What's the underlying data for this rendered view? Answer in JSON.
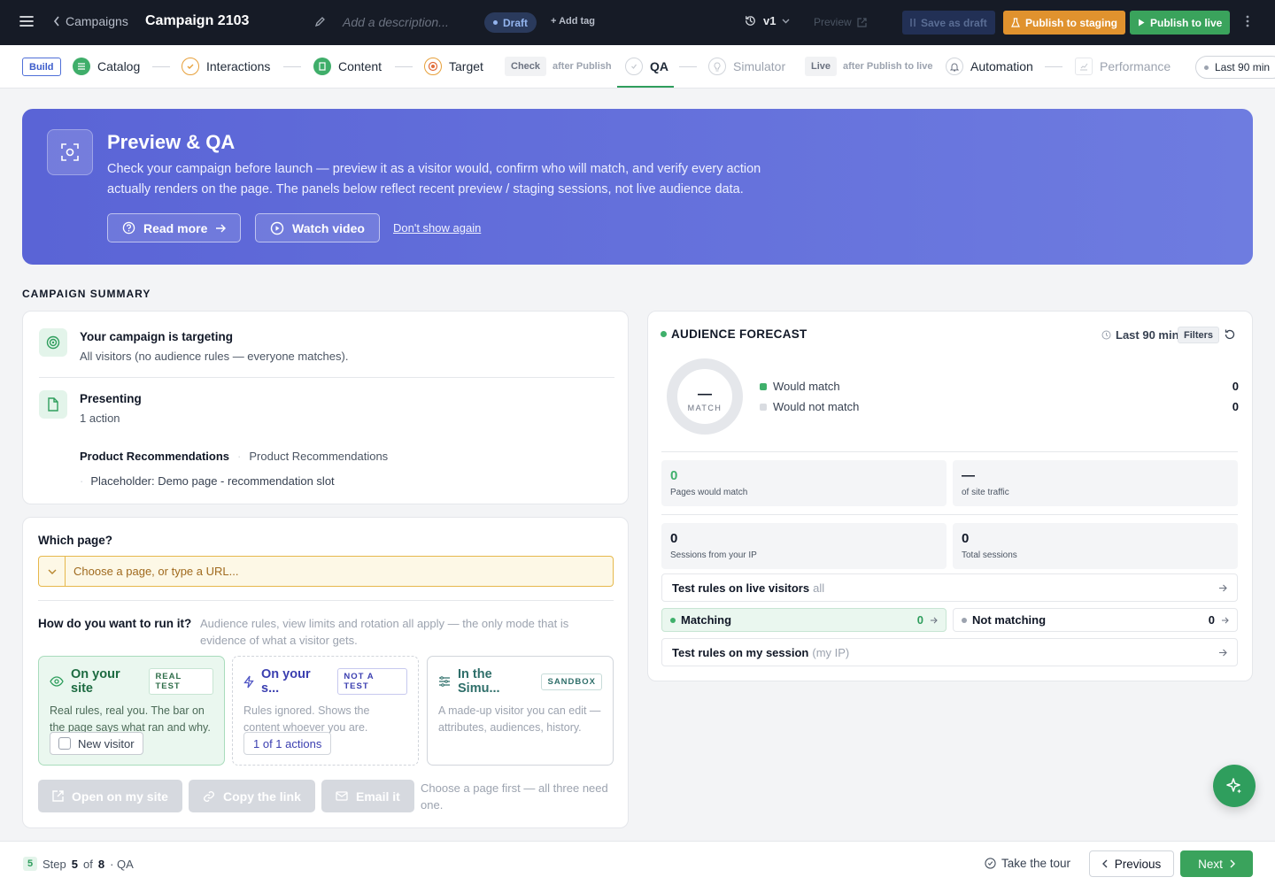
{
  "topbar": {
    "back_label": "Campaigns",
    "campaign_title": "Campaign 2103",
    "description_placeholder": "Add a description...",
    "status": "Draft",
    "add_tag": "+ Add tag",
    "version": "v1",
    "preview": "Preview",
    "save_draft": "Save as draft",
    "publish_staging": "Publish to staging",
    "publish_live": "Publish to live"
  },
  "steps": {
    "build_tag": "Build",
    "items": [
      "Catalog",
      "Interactions",
      "Content",
      "Target",
      "QA",
      "Simulator",
      "Automation",
      "Performance"
    ],
    "check_tag": "Check",
    "check_sub": "after Publish",
    "live_tag": "Live",
    "live_sub": "after Publish to live",
    "range": "Last 90 min"
  },
  "hero": {
    "title": "Preview & QA",
    "body": "Check your campaign before launch — preview it as a visitor would, confirm who will match, and verify every action actually renders on the page. The panels below reflect recent preview / staging sessions, not live audience data.",
    "read_more": "Read more",
    "watch_video": "Watch video",
    "dont_show": "Don't show again"
  },
  "summary": {
    "section": "CAMPAIGN SUMMARY",
    "targeting_title": "Your campaign is targeting",
    "targeting_sub": "All visitors (no audience rules — everyone matches).",
    "presenting_title": "Presenting",
    "presenting_sub": "1 action",
    "action_name": "Product Recommendations",
    "action_type": "Product Recommendations",
    "placeholder": "Placeholder: Demo page - recommendation slot"
  },
  "which_page": {
    "label": "Which page?",
    "input_placeholder": "Choose a page, or type a URL...",
    "run_label": "How do you want to run it?",
    "run_help": "Audience rules, view limits and rotation all apply — the only mode that is evidence of what a visitor gets.",
    "modes": [
      {
        "title": "On your site",
        "badge": "REAL TEST",
        "desc": "Real rules, real you. The bar on the page says what ran and why.",
        "control": "New visitor"
      },
      {
        "title": "On your s...",
        "badge": "NOT A TEST",
        "desc": "Rules ignored. Shows the content whoever you are.",
        "control": "1 of 1 actions"
      },
      {
        "title": "In the Simu...",
        "badge": "SANDBOX",
        "desc": "A made-up visitor you can edit — attributes, audiences, history."
      }
    ],
    "open_site": "Open on my site",
    "copy_link": "Copy the link",
    "email_it": "Email it",
    "hint": "Choose a page first — all three need one."
  },
  "forecast": {
    "title": "AUDIENCE FORECAST",
    "range": "Last 90 min",
    "filters": "Filters",
    "donut_value": "—",
    "donut_label": "MATCH",
    "legend": [
      {
        "label": "Would match",
        "value": "0",
        "color": "#3fb06b"
      },
      {
        "label": "Would not match",
        "value": "0",
        "color": "#d9dce1"
      }
    ],
    "stats": [
      {
        "value": "0",
        "label": "Pages would match"
      },
      {
        "value": "—",
        "label": "of site traffic"
      },
      {
        "value": "0",
        "label": "Sessions from your IP"
      },
      {
        "value": "0",
        "label": "Total sessions"
      }
    ],
    "test_live": "Test rules on live visitors",
    "test_live_scope": "all",
    "matching": "Matching",
    "matching_count": "0",
    "not_matching": "Not matching",
    "not_matching_count": "0",
    "test_session": "Test rules on my session",
    "test_session_scope": "(my IP)"
  },
  "footer": {
    "step_num": "5",
    "step_word": "Step",
    "step_current": "5",
    "step_of": "of",
    "step_total": "8",
    "step_name": "· QA",
    "take_tour": "Take the tour",
    "previous": "Previous",
    "next": "Next"
  },
  "colors": {
    "accent_green": "#2f9e5d",
    "hero": "#5a64d6",
    "staging": "#e0922e"
  }
}
